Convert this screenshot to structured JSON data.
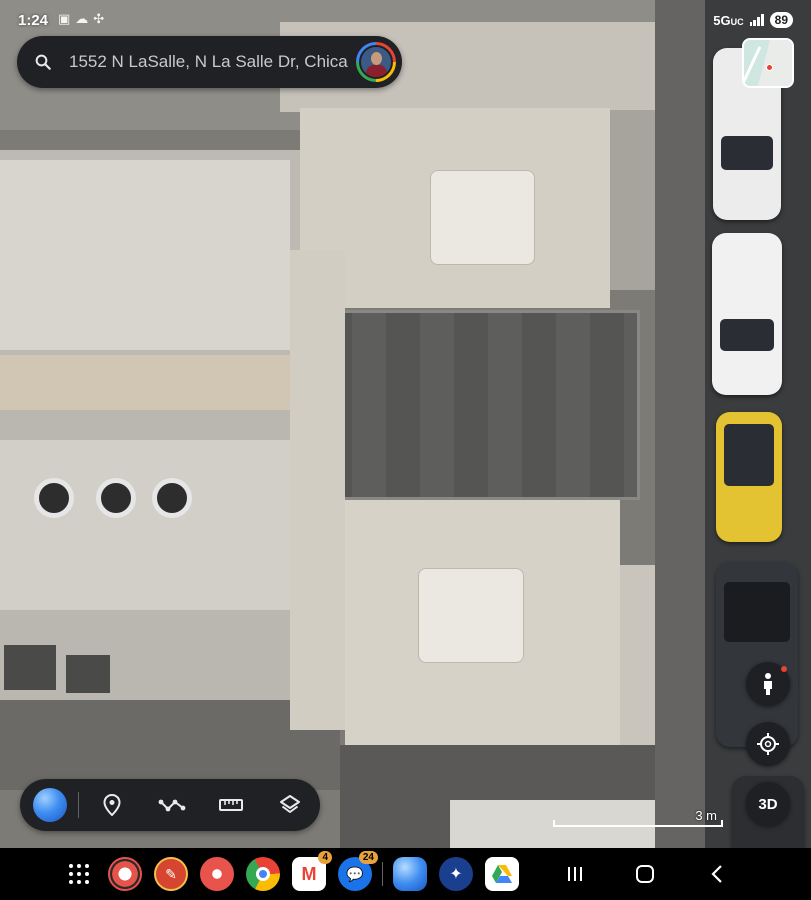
{
  "status_bar": {
    "time": "1:24",
    "network": "5G",
    "network_sub": "UC",
    "battery": "89"
  },
  "search": {
    "value": "1552 N LaSalle, N La Salle Dr, Chica",
    "icon": "search-icon"
  },
  "map": {
    "type": "satellite",
    "scale_label": "3 m"
  },
  "controls": {
    "mode_3d_label": "3D",
    "pegman_icon": "street-view-person-icon",
    "locate_icon": "my-location-icon"
  },
  "toolbar": {
    "items": [
      "globe-icon",
      "pin-icon",
      "route-icon",
      "ruler-icon",
      "layers-icon"
    ]
  },
  "taskbar": {
    "apps": [
      {
        "name": "app-1",
        "badge": ""
      },
      {
        "name": "app-2",
        "badge": ""
      },
      {
        "name": "app-3",
        "badge": ""
      },
      {
        "name": "chrome",
        "badge": ""
      },
      {
        "name": "gmail",
        "badge": "4"
      },
      {
        "name": "messages",
        "badge": "24"
      },
      {
        "name": "earth",
        "badge": ""
      },
      {
        "name": "gemini",
        "badge": ""
      },
      {
        "name": "drive",
        "badge": ""
      }
    ]
  },
  "colors": {
    "panel": "#202124",
    "accent_blue": "#4285f4",
    "red": "#ea4335"
  }
}
